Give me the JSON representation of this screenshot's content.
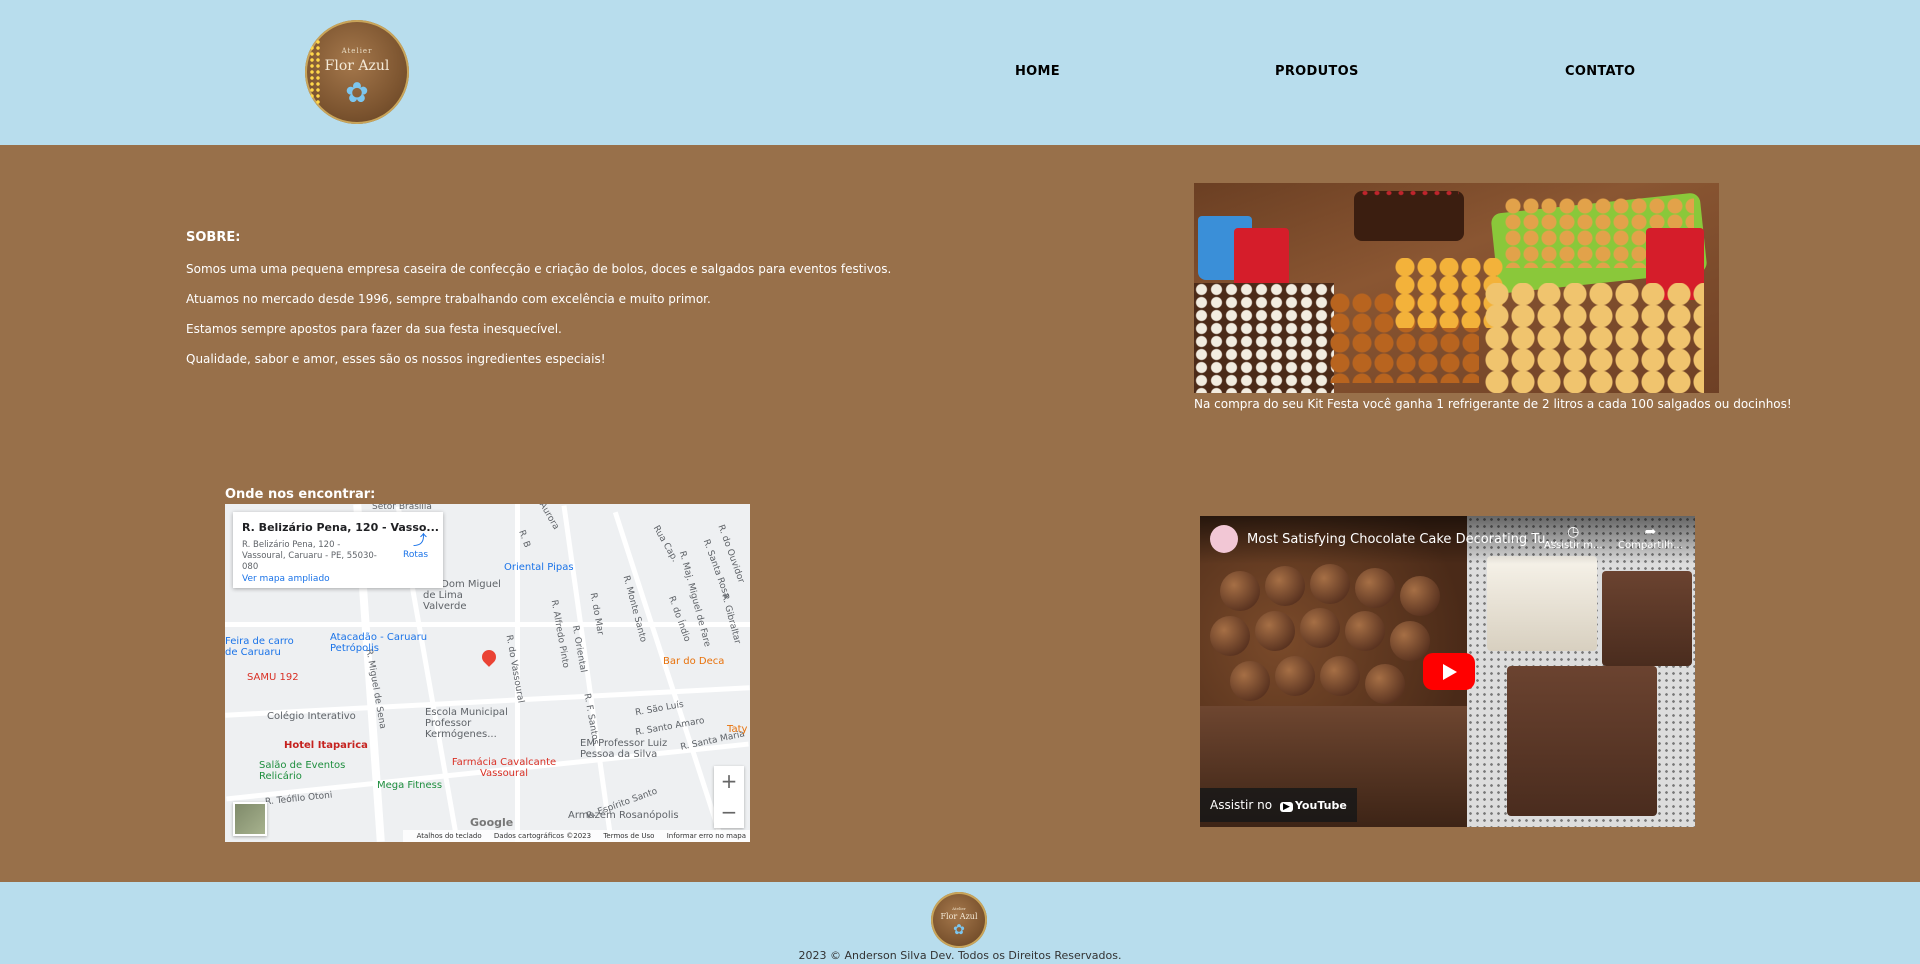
{
  "header": {
    "logo": {
      "small_text": "Atelier",
      "big_text": "Flor Azul"
    },
    "nav": [
      {
        "label": "HOME"
      },
      {
        "label": "PRODUTOS"
      },
      {
        "label": "CONTATO"
      }
    ]
  },
  "about": {
    "title": "SOBRE:",
    "paragraphs": [
      "Somos uma uma pequena empresa caseira de confecção e criação de bolos, doces e salgados para eventos festivos.",
      "Atuamos no mercado desde 1996, sempre trabalhando com excelência e muito primor.",
      "Estamos sempre apostos para fazer da sua festa inesquecível.",
      "Qualidade, sabor e amor, esses são os nossos ingredientes especiais!"
    ]
  },
  "promo": {
    "caption": "Na compra do seu Kit Festa você ganha 1 refrigerante de 2 litros a cada 100 salgados ou docinhos!"
  },
  "map": {
    "heading": "Onde nos encontrar:",
    "card_title": "R. Belizário Pena, 120 - Vasso...",
    "card_address": "R. Belizário Pena, 120 - Vassoural, Caruaru - PE, 55030-080",
    "card_link": "Ver mapa ampliado",
    "directions_label": "Rotas",
    "streets": [
      "R. Aurora",
      "R. B",
      "Rua Cap.",
      "R. Maj. Miguel de Fare",
      "R. Santa Rosa",
      "R. do Índio",
      "R. do Ouvidor",
      "R. do Mar",
      "R. Monte Santo",
      "R. Gibraltar",
      "R. Miguel de Sena",
      "R. do Vassoural",
      "R. Alfredo Pinto",
      "R. Oriental",
      "R. F. Santos",
      "R. São Luís",
      "R. Santo Amaro",
      "R. Santa Maria",
      "R. Espírito Santo",
      "R. Teófilo Otoni",
      "Setor Brasília"
    ],
    "pois": [
      "Oriental Pipas",
      "EM Dom Miguel de Lima Valverde",
      "Feira de carro de Caruaru",
      "Atacadão - Caruaru Petrópolis",
      "SAMU 192",
      "Bar do Deca",
      "Colégio Interativo",
      "Escola Municipal Professor Kermógenes...",
      "Hotel Itaparica",
      "Salão de Eventos Relicário",
      "Farmácia Cavalcante Vassoural",
      "EM Professor Luiz Pessoa da Silva",
      "Mega Fitness",
      "Armazém Rosanópolis",
      "Taty"
    ],
    "google_label": "Google",
    "footer_links": [
      "Atalhos do teclado",
      "Dados cartográficos ©2023",
      "Termos de Uso",
      "Informar erro no mapa"
    ],
    "zoom_in": "+",
    "zoom_out": "−"
  },
  "video": {
    "title": "Most Satisfying Chocolate Cake Decorating Tu...",
    "watch_later": "Assistir m...",
    "share": "Compartilh...",
    "watch_on": "Assistir no",
    "youtube": "YouTube"
  },
  "footer": {
    "copyright": "2023 © Anderson Silva Dev. Todos os Direitos Reservados."
  },
  "colors": {
    "header_bg": "#b8dded",
    "main_bg": "#98704a",
    "text_light": "#ffffff"
  }
}
